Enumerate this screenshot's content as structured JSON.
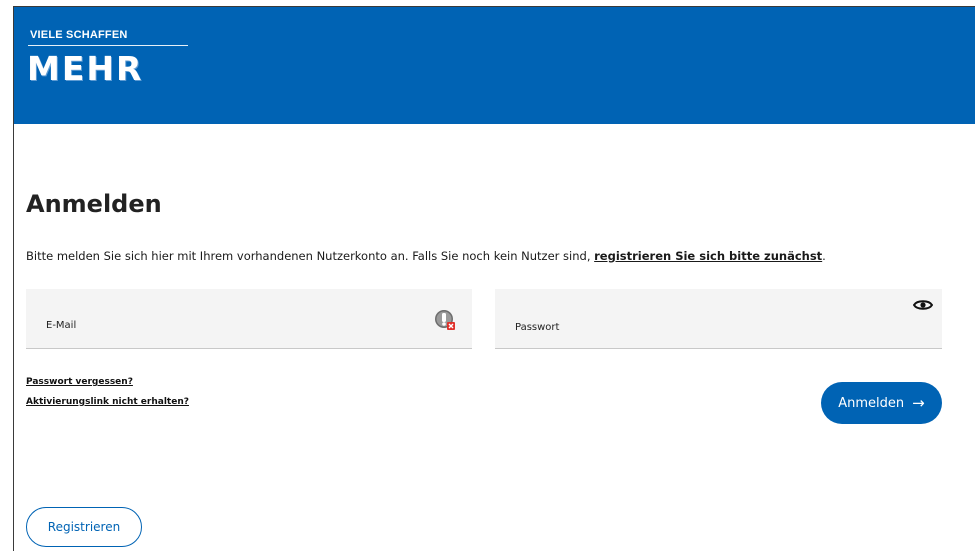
{
  "header": {
    "logo_top": "VIELE SCHAFFEN",
    "logo_word": "MEHR",
    "background": "#0063b4"
  },
  "page": {
    "title": "Anmelden",
    "intro_text": "Bitte melden Sie sich hier mit Ihrem vorhandenen Nutzerkonto an. Falls Sie noch kein Nutzer sind, ",
    "intro_link": "registrieren Sie sich bitte zunächst",
    "intro_end": "."
  },
  "form": {
    "email": {
      "label": "E-Mail",
      "value": "",
      "icon": "autofill-key-icon"
    },
    "password": {
      "label": "Passwort",
      "value": "",
      "icon": "eye-icon"
    },
    "forgot_link": "Passwort vergessen?",
    "activation_link": "Aktivierungslink nicht erhalten?",
    "submit_label": "Anmelden",
    "submit_icon": "arrow-right-icon",
    "register_label": "Registrieren"
  },
  "colors": {
    "accent": "#0063b4",
    "field_bg": "#f4f4f4"
  }
}
